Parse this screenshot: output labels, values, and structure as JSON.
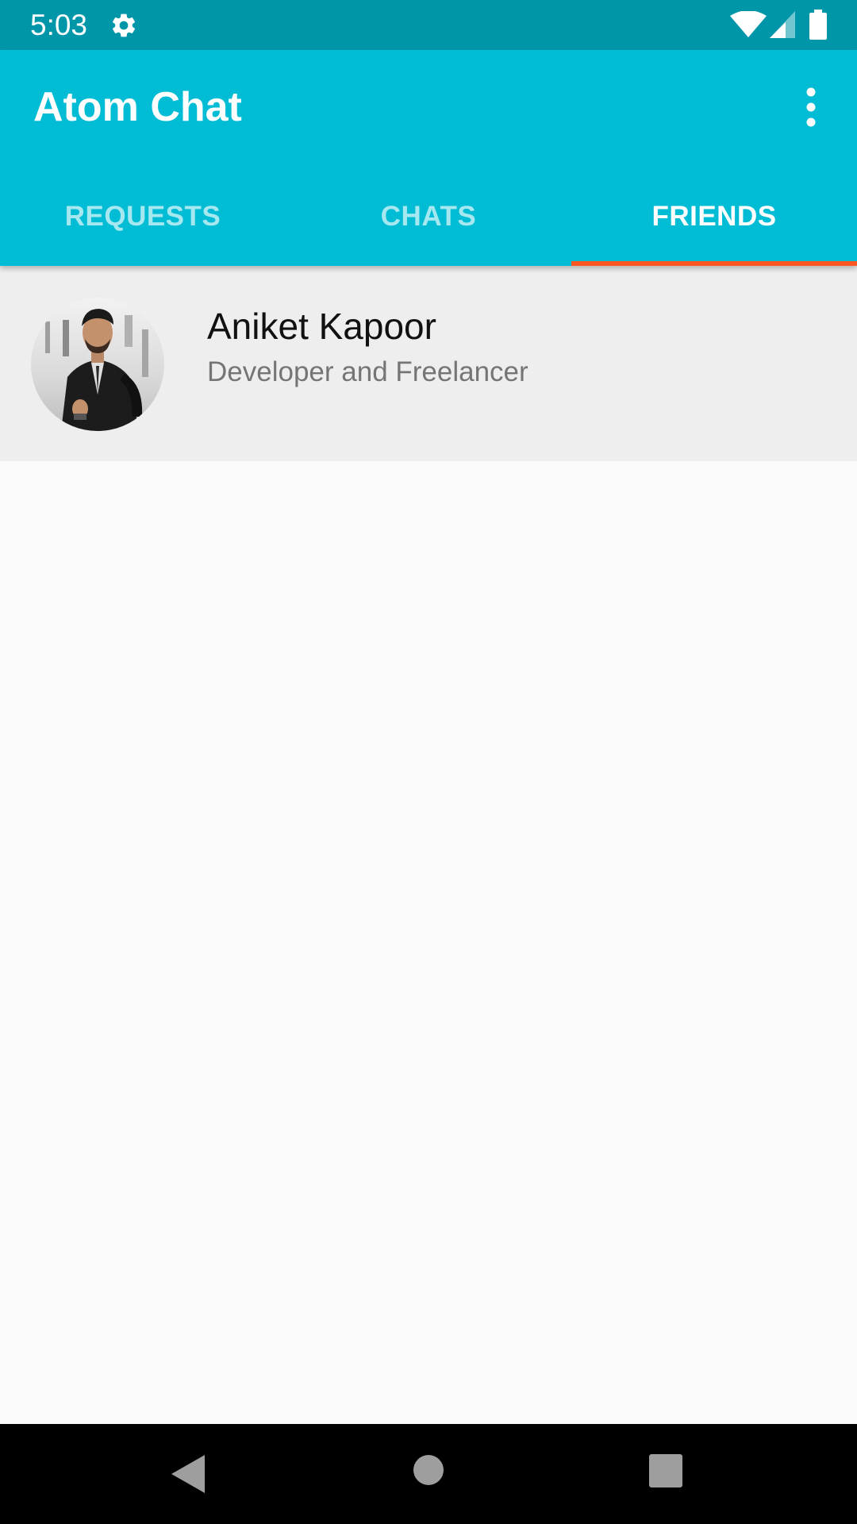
{
  "status_bar": {
    "time": "5:03",
    "icons": [
      "gear-icon",
      "wifi-icon",
      "signal-icon",
      "battery-icon"
    ]
  },
  "app_bar": {
    "title": "Atom Chat",
    "menu_icon": "more-vert-icon",
    "color": "#00bcd4"
  },
  "tabs": [
    {
      "label": "REQUESTS",
      "active": false
    },
    {
      "label": "CHATS",
      "active": false
    },
    {
      "label": "FRIENDS",
      "active": true
    }
  ],
  "tab_indicator_color": "#ff5722",
  "friends": [
    {
      "name": "Aniket Kapoor",
      "status": "Developer and Freelancer",
      "avatar": "profile-photo"
    }
  ],
  "nav_bar": {
    "icons": [
      "back-icon",
      "home-icon",
      "recents-icon"
    ]
  }
}
